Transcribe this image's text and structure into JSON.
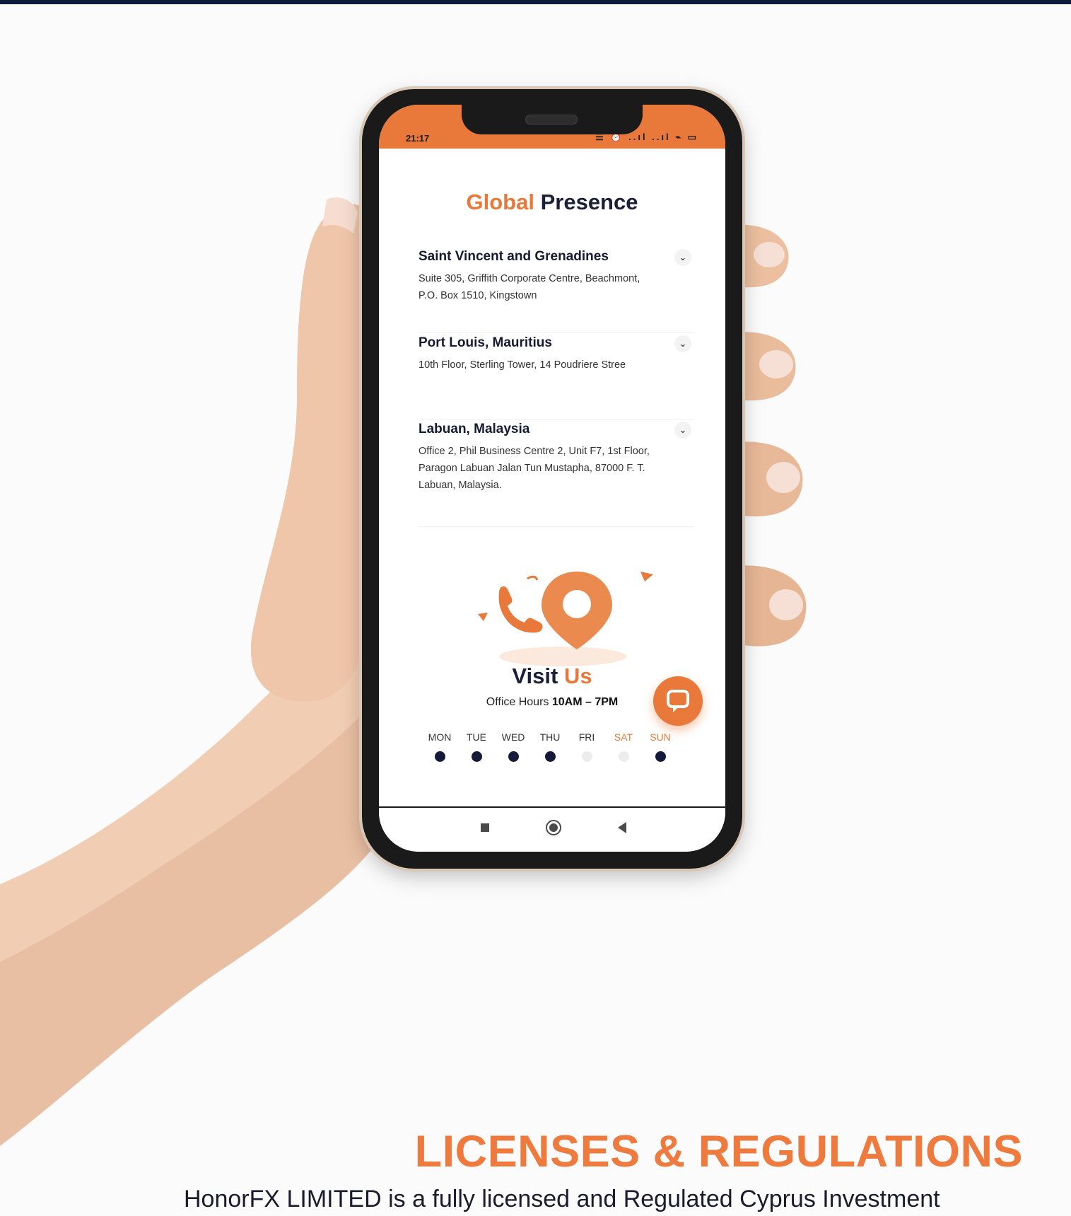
{
  "status_bar": {
    "time": "21:17",
    "icons": "☰ ⏰   ..ıl ..ıl ⌁ ▭"
  },
  "global_presence": {
    "title_accent": "Global",
    "title_rest": "Presence"
  },
  "offices": [
    {
      "name": "Saint Vincent and Grenadines",
      "address": "Suite 305, Griffith Corporate Centre, Beachmont, P.O. Box 1510, Kingstown"
    },
    {
      "name": "Port Louis, Mauritius",
      "address": "10th Floor, Sterling Tower, 14 Poudriere Stree"
    },
    {
      "name": "Labuan, Malaysia",
      "address": "Office 2, Phil Business Centre 2, Unit F7, 1st Floor, Paragon Labuan Jalan Tun Mustapha, 87000 F. T. Labuan, Malaysia."
    }
  ],
  "visit": {
    "title_main": "Visit",
    "title_accent": "Us",
    "hours_prefix": "Office Hours",
    "hours_value": "10AM – 7PM"
  },
  "days": [
    {
      "label": "MON",
      "open": true
    },
    {
      "label": "TUE",
      "open": true
    },
    {
      "label": "WED",
      "open": true
    },
    {
      "label": "THU",
      "open": true
    },
    {
      "label": "FRI",
      "open": false
    },
    {
      "label": "SAT",
      "open": false
    },
    {
      "label": "SUN",
      "open": true
    }
  ],
  "licenses": {
    "title": "LICENSES & REGULATIONS",
    "text": "HonorFX LIMITED is a fully licensed and Regulated Cyprus Investment"
  },
  "colors": {
    "accent": "#e8793a",
    "navy": "#171a33"
  }
}
